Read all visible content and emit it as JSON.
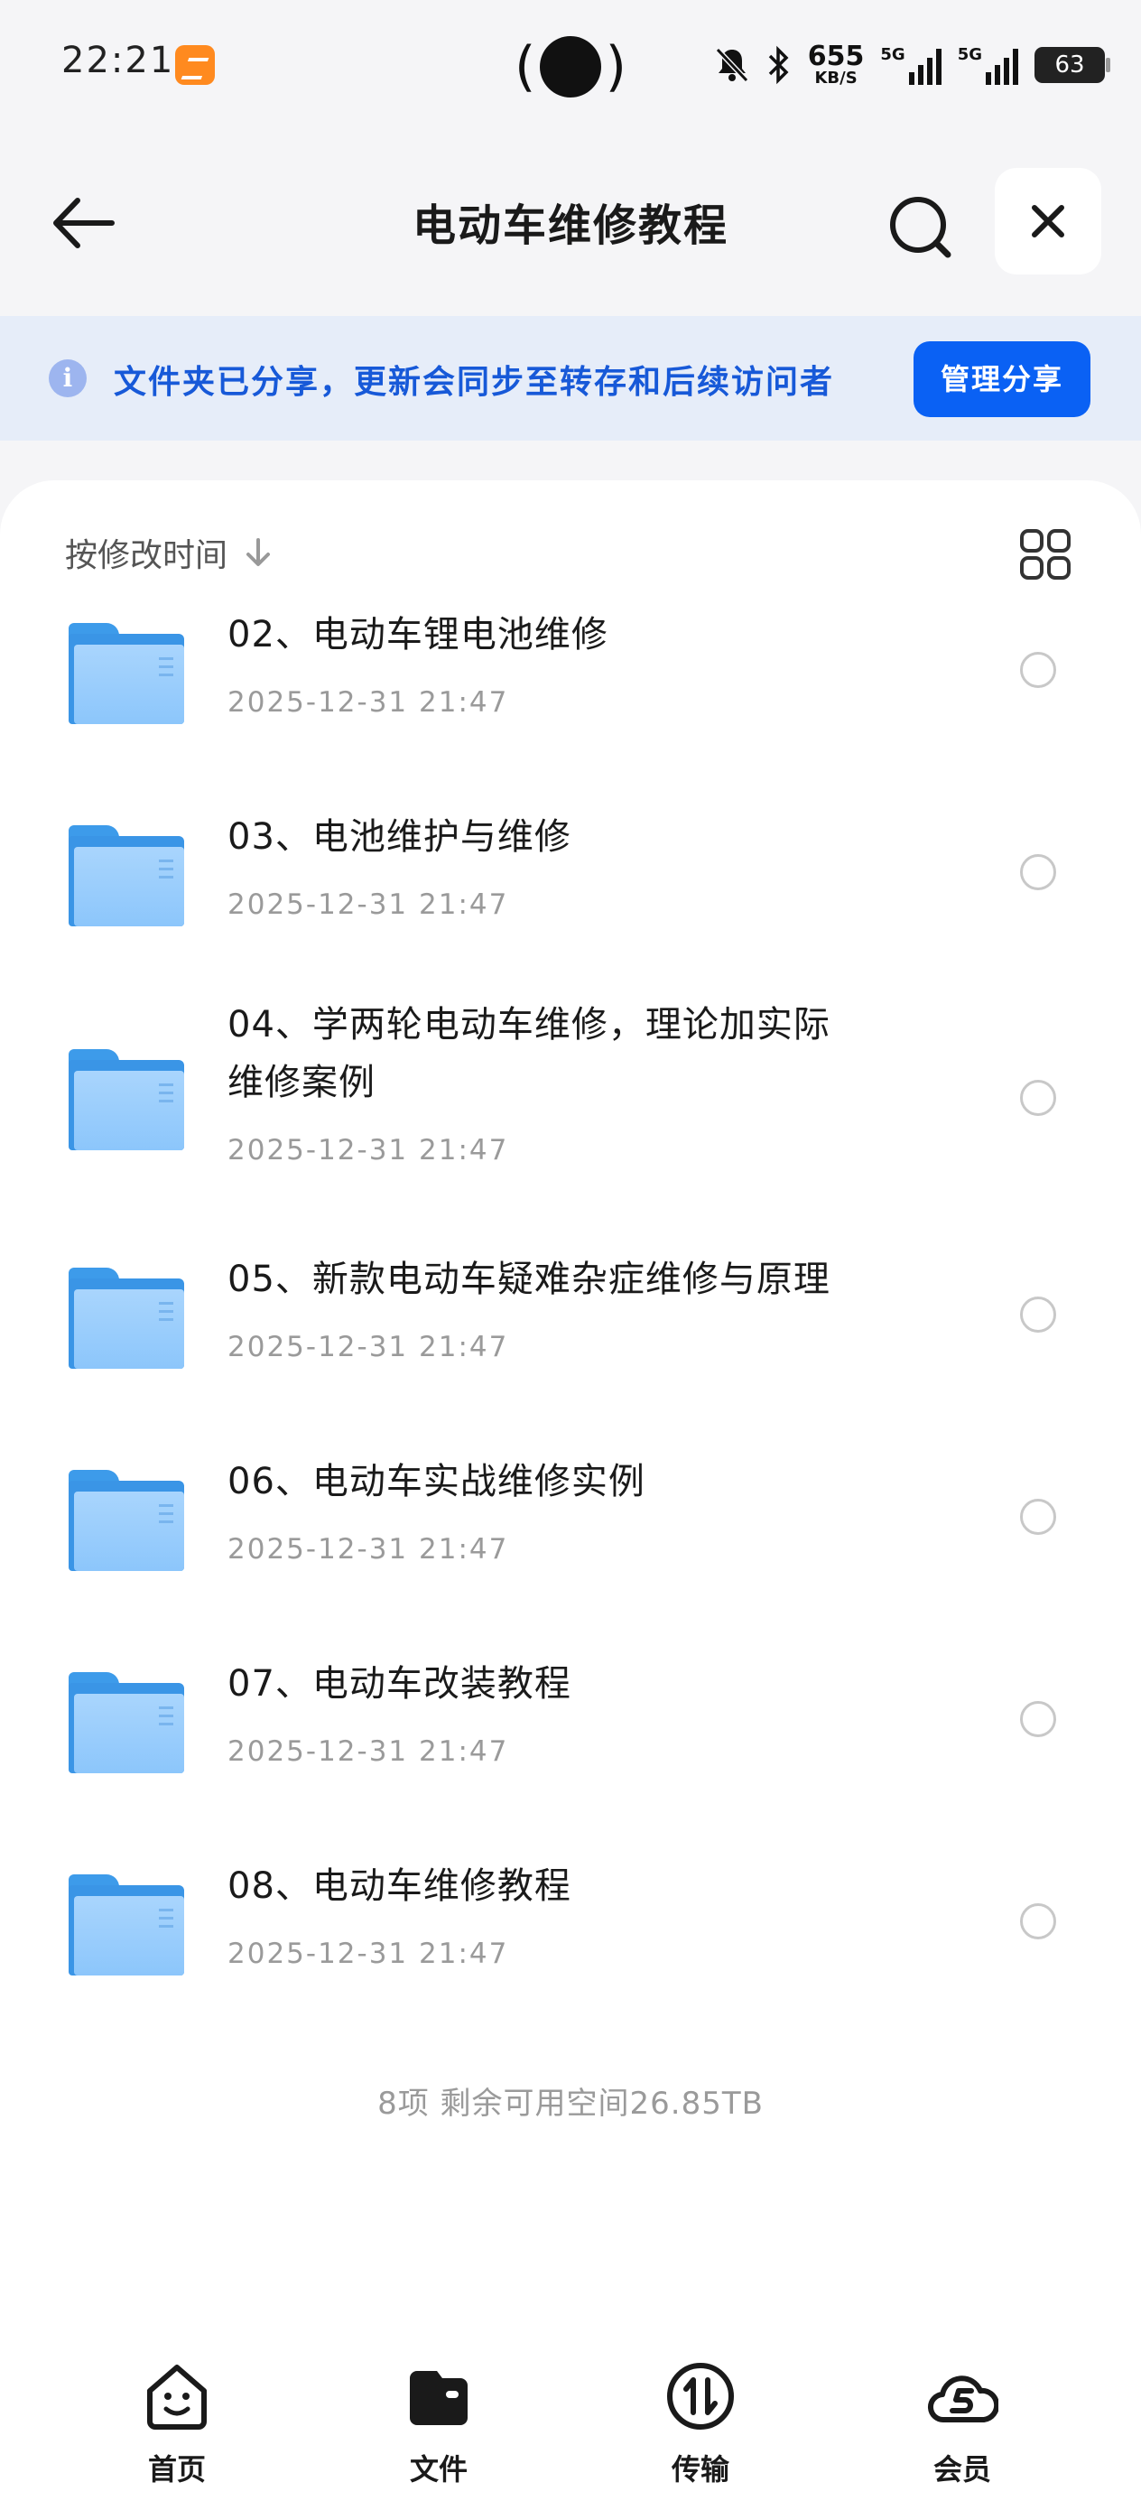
{
  "status_bar": {
    "time": "22:21",
    "net_speed_value": "655",
    "net_speed_unit": "KB/S",
    "sim1_label": "5G",
    "sim2_label": "5G",
    "battery": "63"
  },
  "header": {
    "title": "电动车维修教程"
  },
  "banner": {
    "text": "文件夹已分享，更新会同步至转存和后续访问者",
    "button_label": "管理分享"
  },
  "sort": {
    "label": "按修改时间"
  },
  "files": [
    {
      "name_line1": "02、电动车锂电池维修",
      "name_line2": "",
      "date": "2025-12-31 21:47"
    },
    {
      "name_line1": "03、电池维护与维修",
      "name_line2": "",
      "date": "2025-12-31 21:47"
    },
    {
      "name_line1": "04、学两轮电动车维修，理论加实际",
      "name_line2": "维修案例",
      "date": "2025-12-31 21:47"
    },
    {
      "name_line1": "05、新款电动车疑难杂症维修与原理",
      "name_line2": "",
      "date": "2025-12-31 21:47"
    },
    {
      "name_line1": "06、电动车实战维修实例",
      "name_line2": "",
      "date": "2025-12-31 21:47"
    },
    {
      "name_line1": "07、电动车改装教程",
      "name_line2": "",
      "date": "2025-12-31 21:47"
    },
    {
      "name_line1": "08、电动车维修教程",
      "name_line2": "",
      "date": "2025-12-31 21:47"
    }
  ],
  "summary": "8项 剩余可用空间26.85TB",
  "tabbar": {
    "home": "首页",
    "files": "文件",
    "transfer": "传输",
    "vip": "会员"
  },
  "colors": {
    "accent": "#0a61f4",
    "banner_bg": "#e6edf9",
    "banner_text": "#1759d8",
    "folder": "#8cc6fb"
  }
}
